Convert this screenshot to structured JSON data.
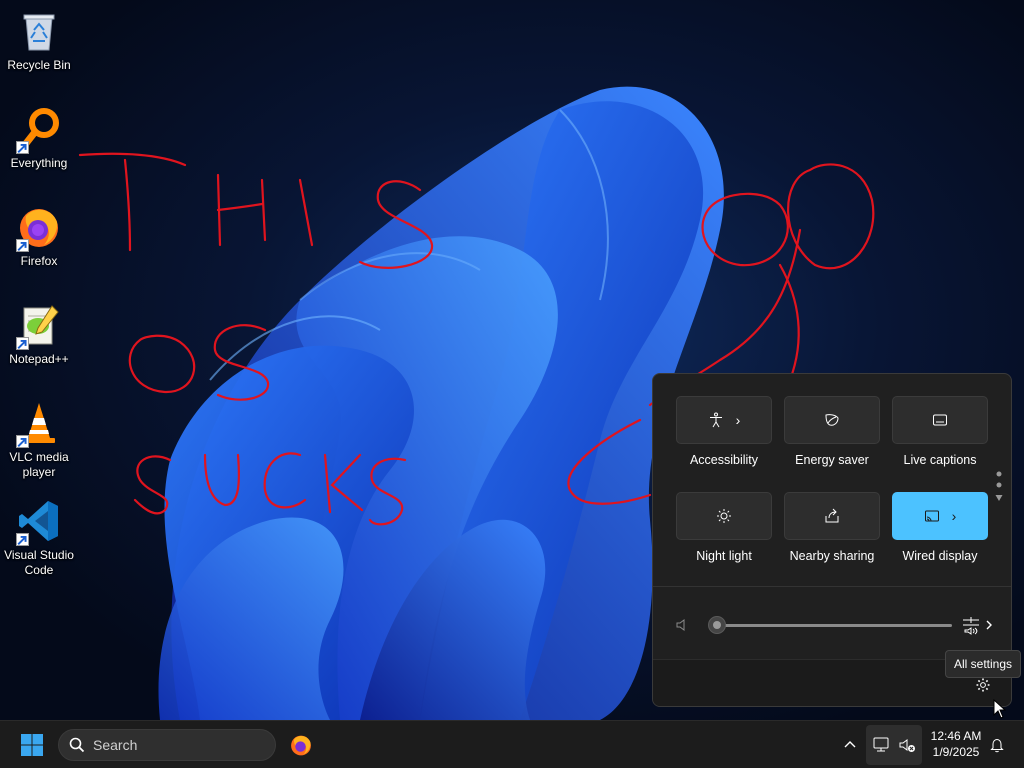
{
  "desktop": {
    "icons": [
      {
        "label": "Recycle Bin",
        "icon": "recycle-bin-icon",
        "shortcut": false
      },
      {
        "label": "Everything",
        "icon": "everything-search-icon",
        "shortcut": true
      },
      {
        "label": "Firefox",
        "icon": "firefox-icon",
        "shortcut": true
      },
      {
        "label": "Notepad++",
        "icon": "notepad-plus-plus-icon",
        "shortcut": true
      },
      {
        "label": "VLC media\nplayer",
        "icon": "vlc-cone-icon",
        "shortcut": true
      },
      {
        "label": "Visual Studio\nCode",
        "icon": "vscode-icon",
        "shortcut": true
      }
    ]
  },
  "quick_settings": {
    "tiles": [
      {
        "label": "Accessibility",
        "icon": "accessibility-icon",
        "has_chevron": true,
        "active": false
      },
      {
        "label": "Energy saver",
        "icon": "energy-saver-leaf-icon",
        "has_chevron": false,
        "active": false
      },
      {
        "label": "Live captions",
        "icon": "live-captions-icon",
        "has_chevron": false,
        "active": false
      },
      {
        "label": "Night light",
        "icon": "night-light-sun-icon",
        "has_chevron": false,
        "active": false
      },
      {
        "label": "Nearby sharing",
        "icon": "nearby-sharing-icon",
        "has_chevron": false,
        "active": false
      },
      {
        "label": "Wired display",
        "icon": "cast-icon",
        "has_chevron": true,
        "active": true
      }
    ],
    "chevron": "›",
    "volume": {
      "level_percent": 0,
      "muted_icon": "speaker-icon"
    },
    "accent": "#4cc2ff"
  },
  "tooltip": {
    "text": "All settings"
  },
  "taskbar": {
    "search_placeholder": "Search",
    "clock": {
      "time": "12:46 AM",
      "date": "1/9/2025"
    }
  },
  "colors": {
    "scribble": "#e0141e",
    "taskbar_bg": "#1c1c1c",
    "panel_bg": "#202020"
  }
}
